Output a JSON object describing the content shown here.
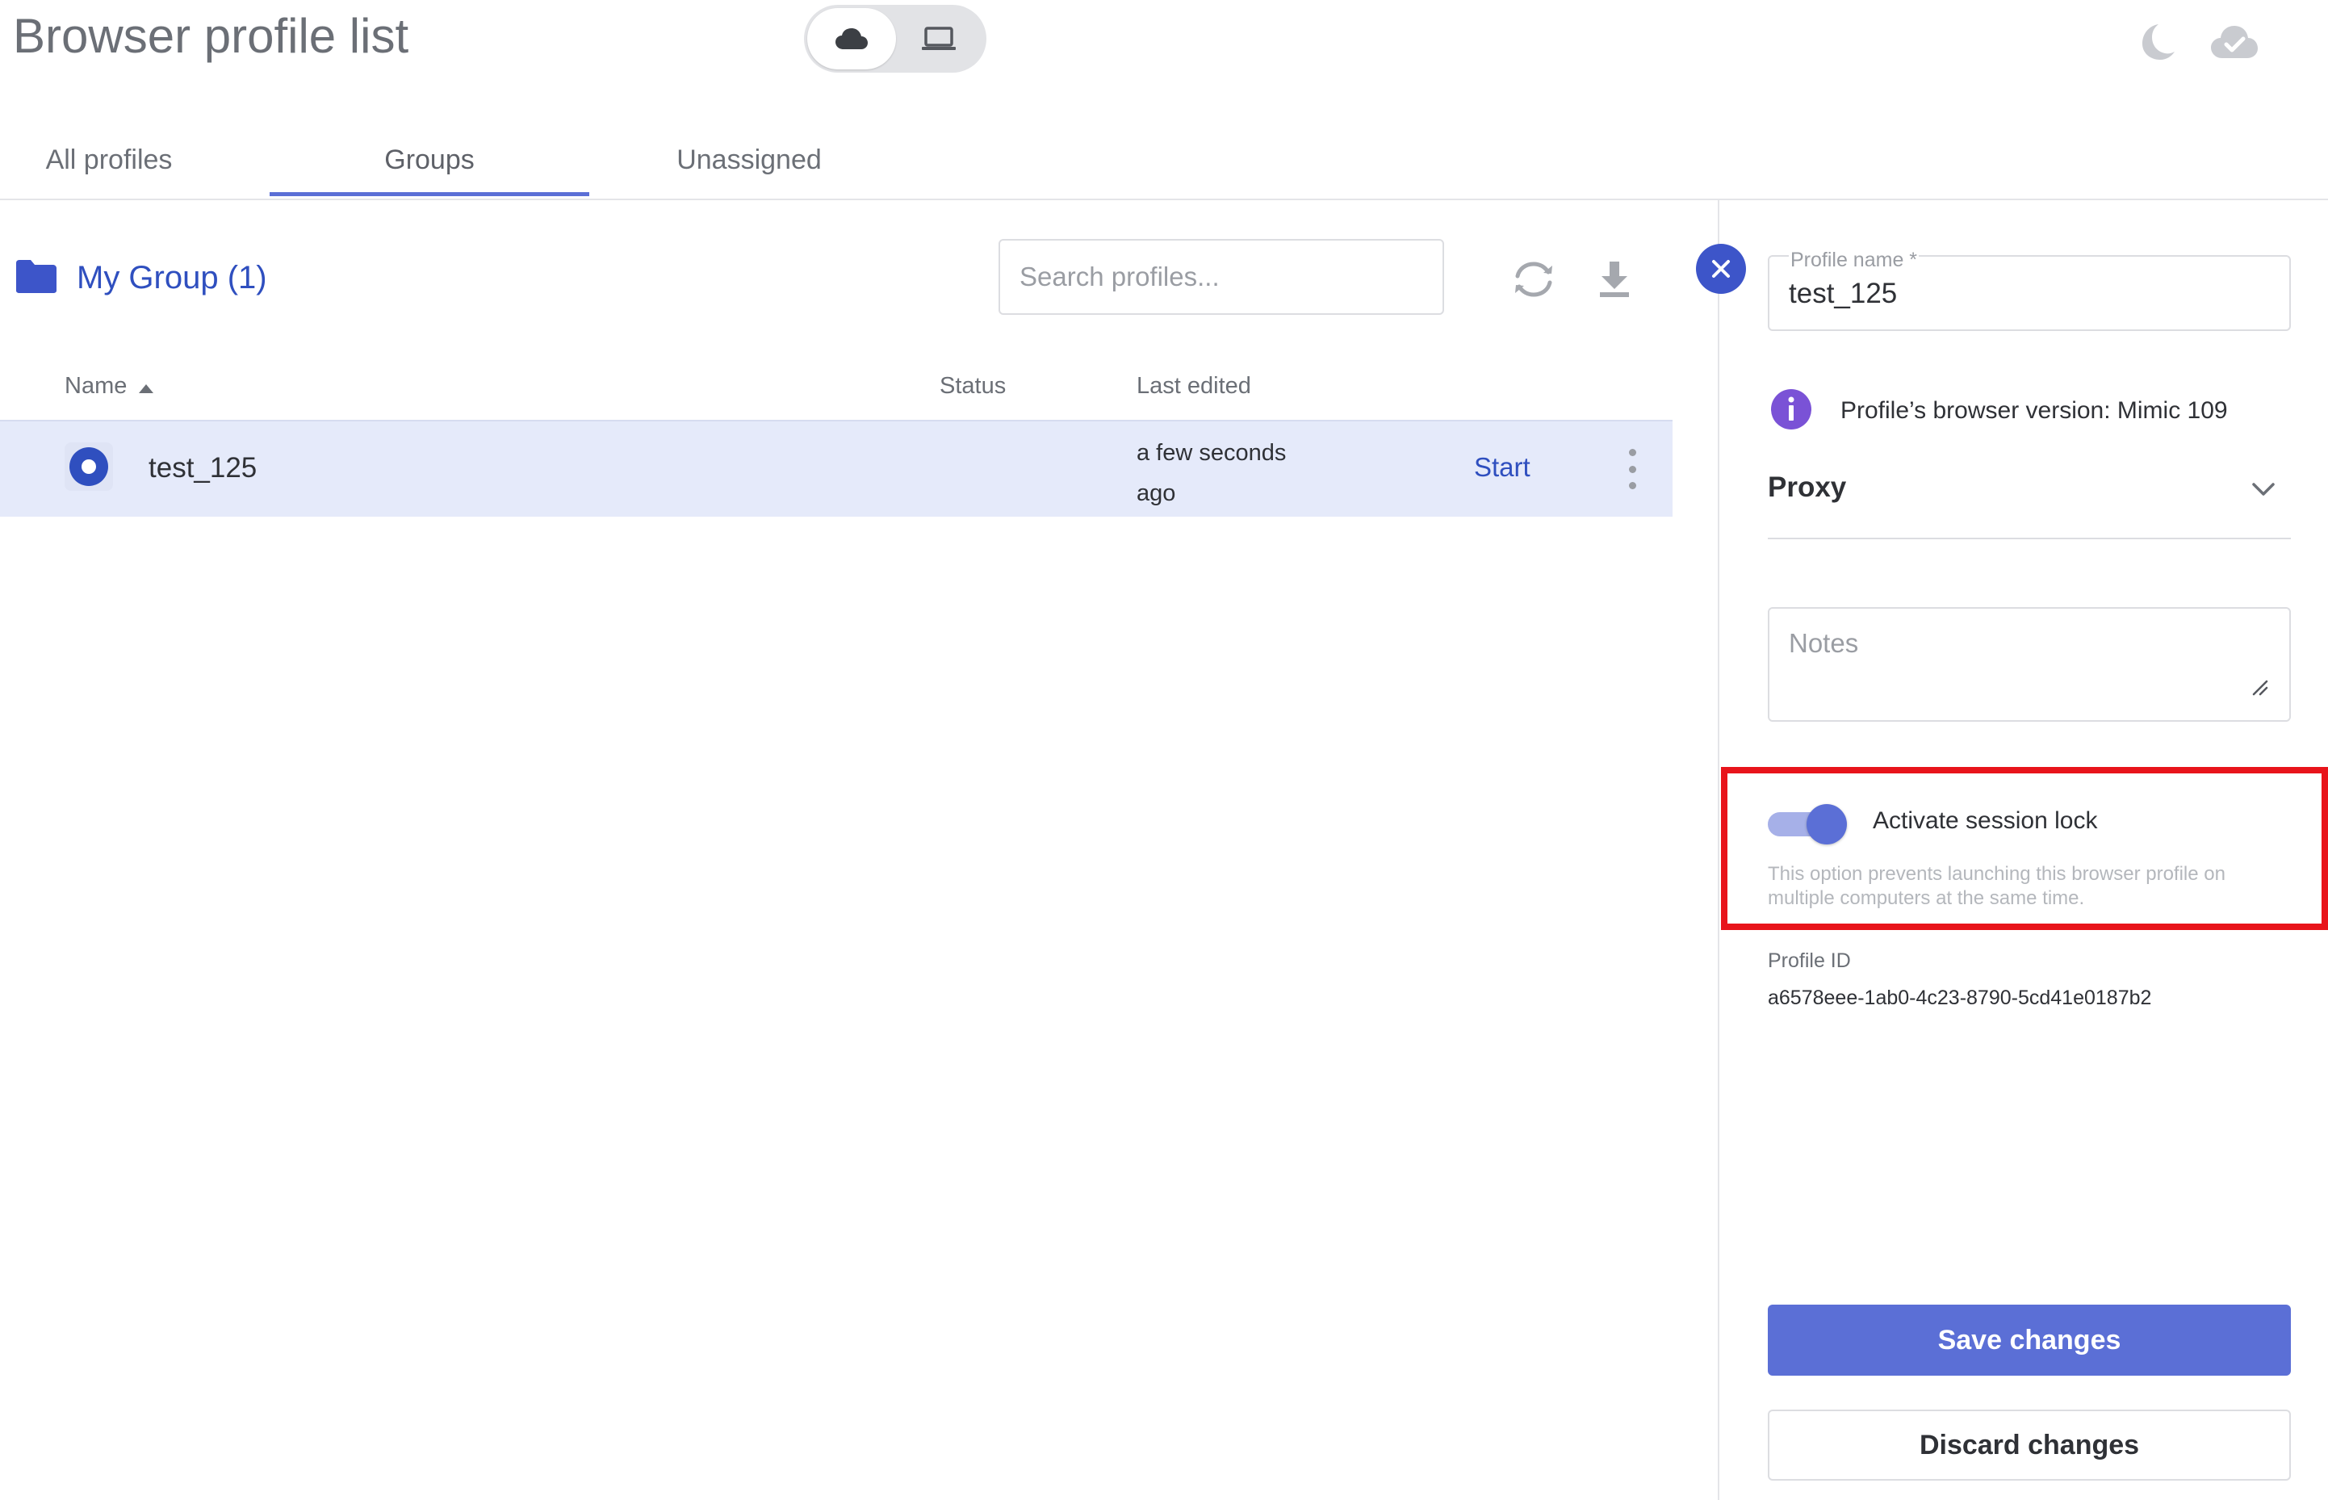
{
  "header": {
    "title": "Browser profile list",
    "mode_toggle": {
      "options": [
        "cloud-icon",
        "laptop-icon"
      ],
      "selected": "cloud"
    },
    "icons": [
      "moon-icon",
      "cloud-check-icon"
    ]
  },
  "tabs": [
    {
      "label": "All profiles",
      "active": false
    },
    {
      "label": "Groups",
      "active": true
    },
    {
      "label": "Unassigned",
      "active": false
    }
  ],
  "group": {
    "title": "My Group (1)",
    "search_placeholder": "Search profiles...",
    "tools": [
      "refresh-icon",
      "download-icon"
    ]
  },
  "table": {
    "columns": [
      "Name",
      "Status",
      "Last edited"
    ],
    "sort": {
      "column": "Name",
      "direction": "asc"
    },
    "rows": [
      {
        "name": "test_125",
        "status": "",
        "last_edited": "a few seconds ago",
        "action": "Start"
      }
    ]
  },
  "panel": {
    "profile_name_label": "Profile name *",
    "profile_name_value": "test_125",
    "browser_version_text": "Profile’s browser version: Mimic 109",
    "proxy_label": "Proxy",
    "notes_placeholder": "Notes",
    "session_lock": {
      "label": "Activate session lock",
      "enabled": true,
      "description": "This option prevents launching this browser profile on multiple computers at the same time."
    },
    "profile_id_label": "Profile ID",
    "profile_id_value": "a6578eee-1ab0-4c23-8790-5cd41e0187b2",
    "save_label": "Save changes",
    "discard_label": "Discard changes"
  },
  "colors": {
    "accent": "#5b6fd6",
    "link": "#2f4fbf",
    "selected_row": "#e5eafa",
    "highlight": "#e8141b",
    "info": "#7a52d6"
  }
}
